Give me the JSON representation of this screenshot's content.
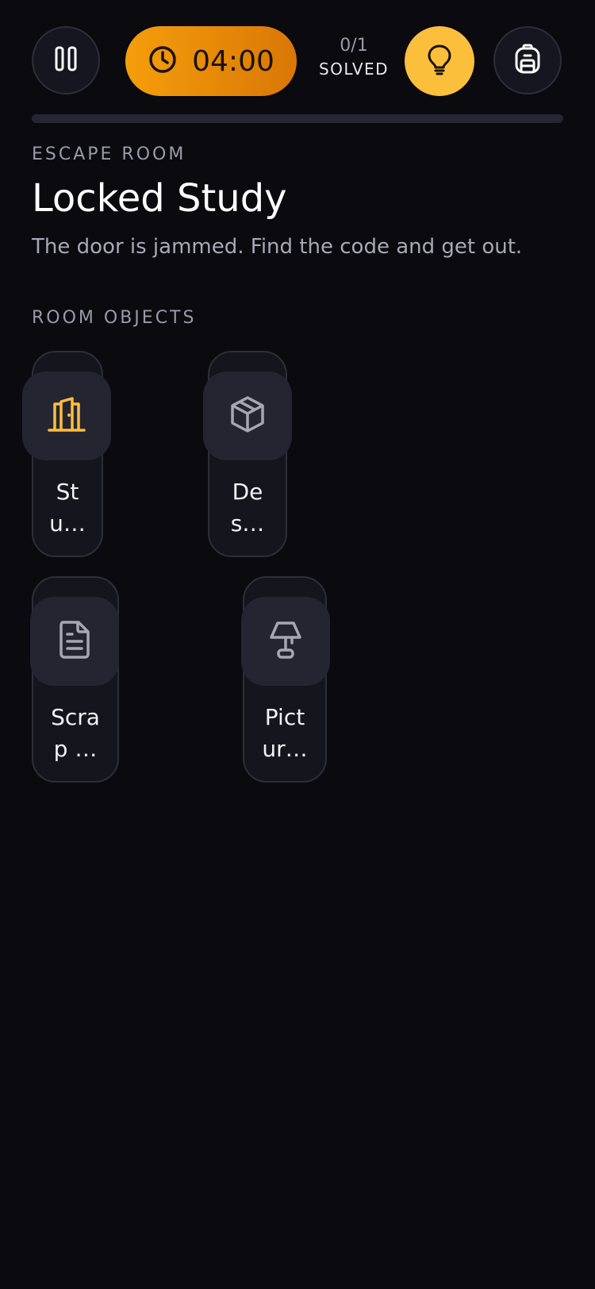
{
  "topbar": {
    "timer": "04:00",
    "solved_count": "0/1",
    "solved_label": "SOLVED",
    "progress_fraction": 0.0
  },
  "header": {
    "eyebrow": "ESCAPE ROOM",
    "title": "Locked Study",
    "subtitle": "The door is jammed. Find the code and get out."
  },
  "objects": {
    "section_label": "ROOM OBJECTS",
    "items": [
      {
        "label_line1": "St",
        "label_line2": "u…",
        "icon": "door-icon",
        "icon_color": "#fbbf3c"
      },
      {
        "label_line1": "De",
        "label_line2": "s…",
        "icon": "box-icon",
        "icon_color": "#a6a6b4"
      },
      {
        "label_line1": "Scra",
        "label_line2": "p …",
        "icon": "document-icon",
        "icon_color": "#a6a6b4"
      },
      {
        "label_line1": "Pict",
        "label_line2": "ur…",
        "icon": "lamp-icon",
        "icon_color": "#a6a6b4"
      }
    ]
  },
  "colors": {
    "background": "#0a0a0f",
    "accent": "#fbbf3c",
    "timer_gradient_start": "#f59e0b",
    "timer_gradient_end": "#d97706"
  }
}
